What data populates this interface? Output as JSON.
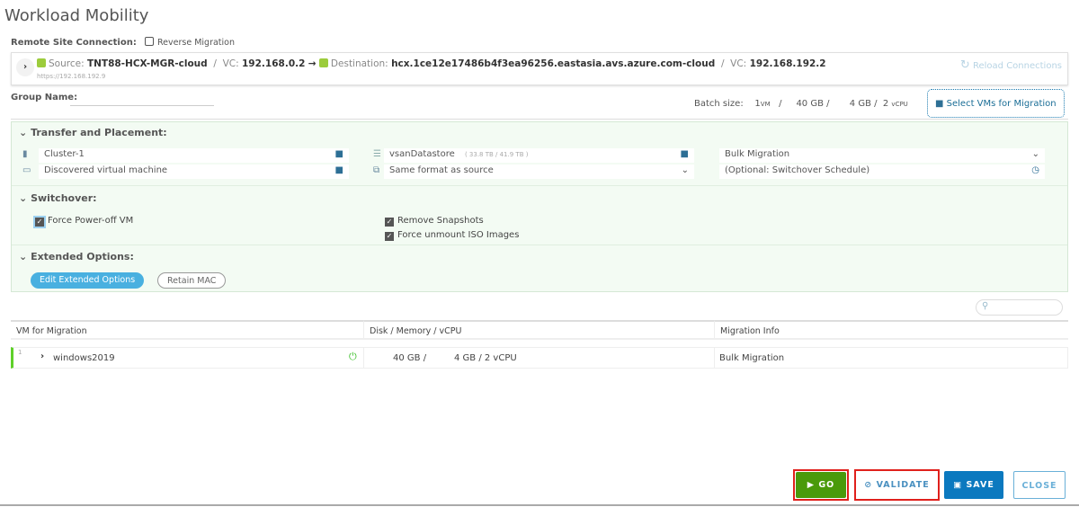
{
  "title": "Workload Mobility",
  "remote_site_label": "Remote Site Connection:",
  "reverse_migration": "Reverse Migration",
  "connection": {
    "source_label": "Source:",
    "source": "TNT88-HCX-MGR-cloud",
    "vc_label": "VC:",
    "source_vc": "192.168.0.2",
    "arrow": "→",
    "dest_label": "Destination:",
    "destination": "hcx.1ce12e17486b4f3ea96256.eastasia.avs.azure.com-cloud",
    "dest_vc": "192.168.192.2",
    "url": "https://192.168.192.9",
    "sep": "/",
    "reload": "Reload Connections"
  },
  "group_name_label": "Group Name:",
  "batch": {
    "label": "Batch size:",
    "vms": "1",
    "vm_unit": "VM",
    "disk": "40 GB",
    "memory": "4 GB",
    "vcpu": "2",
    "vcpu_unit": "vCPU",
    "sep": "/"
  },
  "select_vms": "Select VMs for Migration",
  "transfer": {
    "heading": "Transfer and Placement:",
    "cluster": "Cluster-1",
    "folder": "Discovered virtual machine",
    "datastore": "vsanDatastore",
    "datastore_cap": "( 33.8 TB / 41.9 TB )",
    "disk_format": "Same format as source",
    "migration_type": "Bulk Migration",
    "schedule": "(Optional: Switchover Schedule)"
  },
  "switchover": {
    "heading": "Switchover:",
    "force_poweroff": "Force Power-off VM",
    "remove_snapshots": "Remove Snapshots",
    "force_unmount": "Force unmount ISO Images"
  },
  "extended": {
    "heading": "Extended Options:",
    "edit": "Edit Extended Options",
    "retain_mac": "Retain MAC"
  },
  "table": {
    "headers": [
      "VM for Migration",
      "Disk / Memory / vCPU",
      "Migration Info"
    ],
    "rows": [
      {
        "index": "1",
        "name": "windows2019",
        "disk": "40 GB /",
        "memvcpu": "4 GB / 2 vCPU",
        "info": "Bulk Migration"
      }
    ]
  },
  "buttons": {
    "go": "GO",
    "validate": "VALIDATE",
    "save": "SAVE",
    "close": "CLOSE"
  },
  "colors": {
    "go": "#4a9a0b",
    "save": "#0b79bf",
    "highlight": "#e0201c",
    "panel": "#f3fbf3"
  }
}
